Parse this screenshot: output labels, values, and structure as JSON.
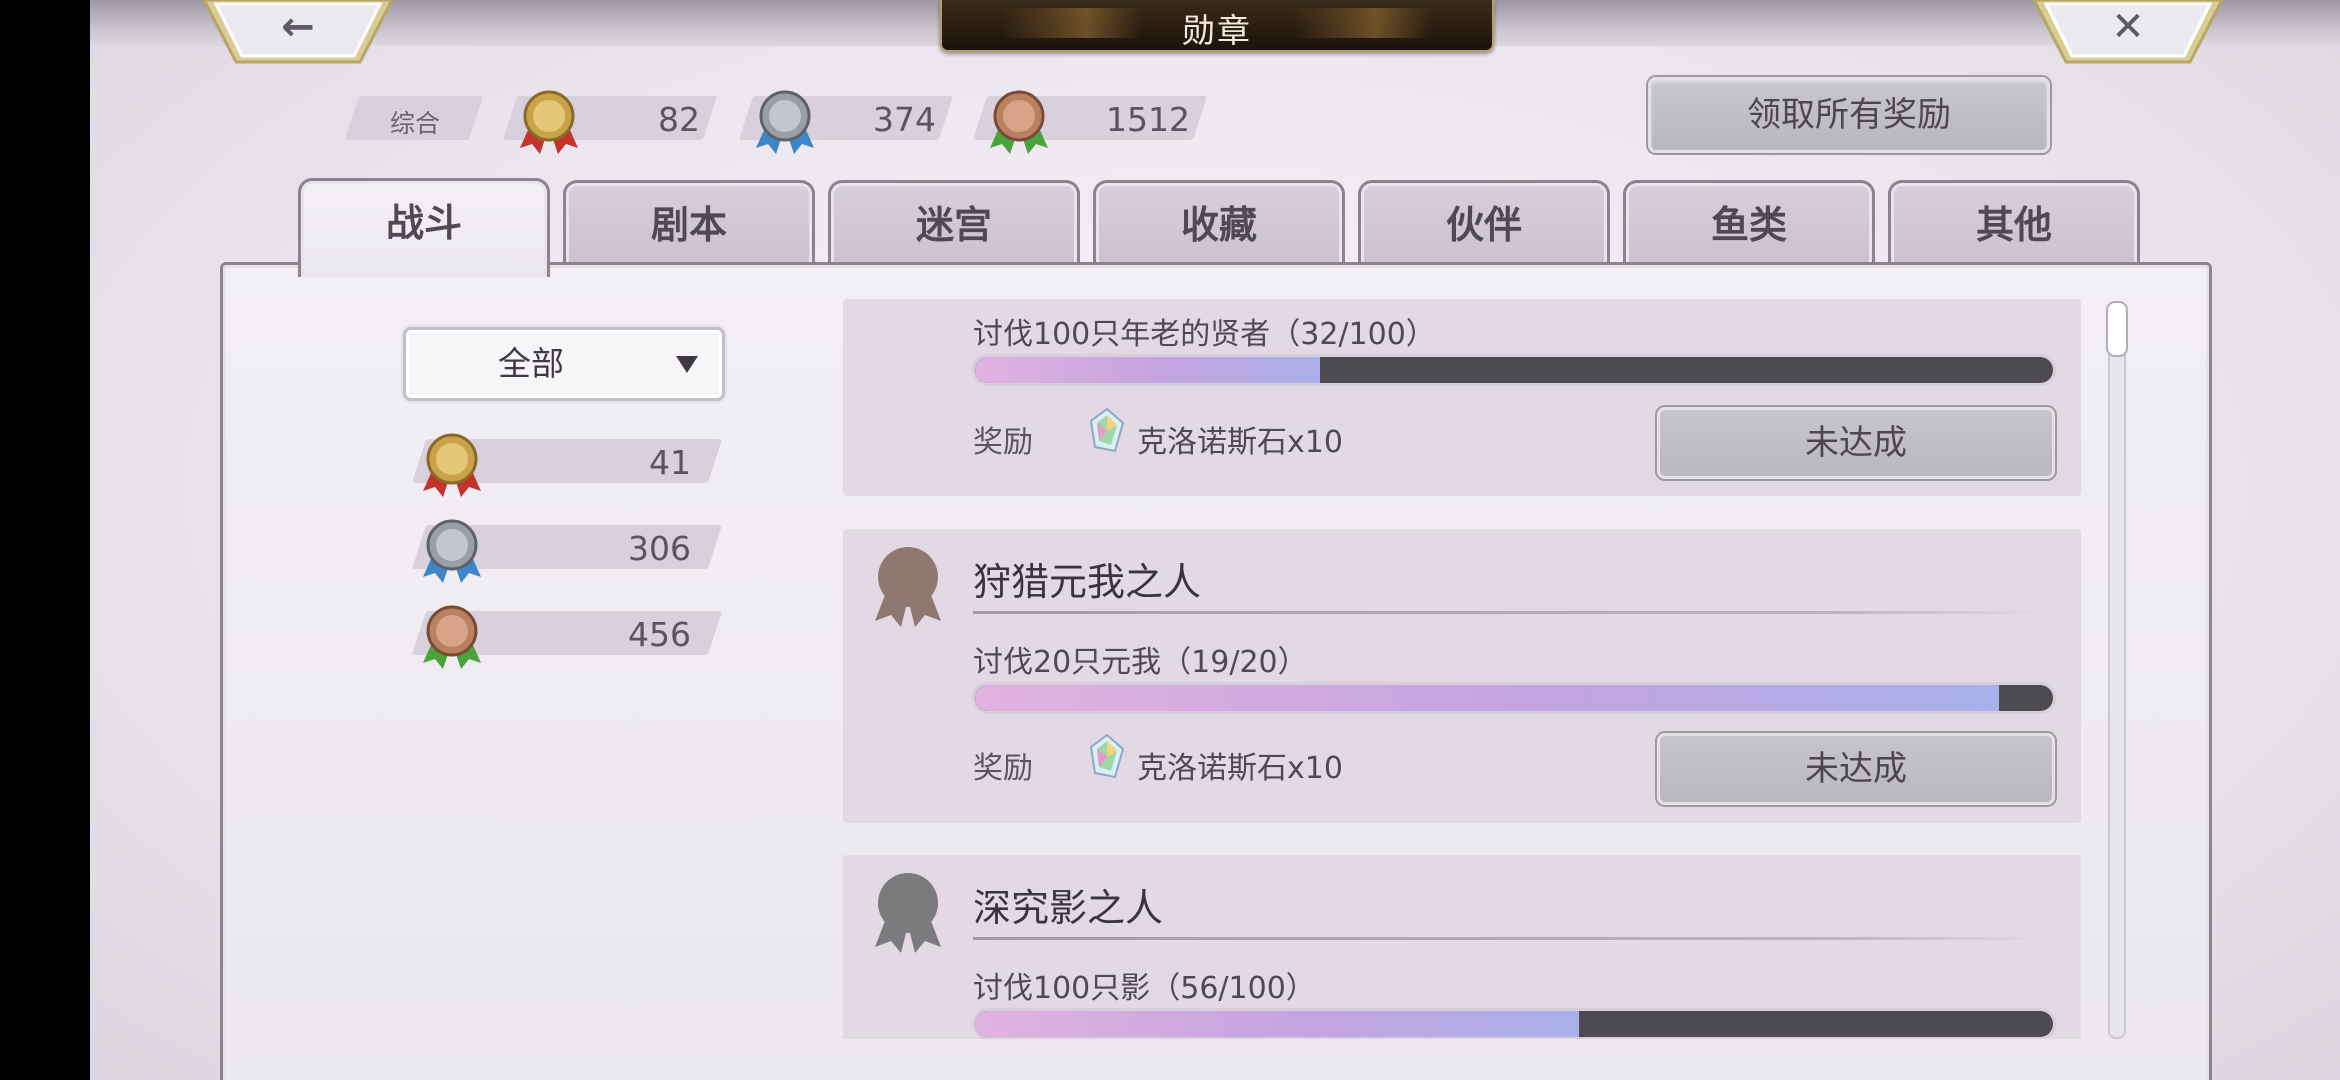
{
  "header": {
    "title": "勋章",
    "back_glyph": "←",
    "close_glyph": "✕"
  },
  "summary": {
    "label": "综合",
    "gold": "82",
    "silver": "374",
    "bronze": "1512"
  },
  "claim_all_label": "领取所有奖励",
  "tabs": [
    {
      "label": "战斗",
      "active": true
    },
    {
      "label": "剧本",
      "active": false
    },
    {
      "label": "迷宫",
      "active": false
    },
    {
      "label": "收藏",
      "active": false
    },
    {
      "label": "伙伴",
      "active": false
    },
    {
      "label": "鱼类",
      "active": false
    },
    {
      "label": "其他",
      "active": false
    }
  ],
  "filter": {
    "selected": "全部"
  },
  "category_counts": {
    "gold": "41",
    "silver": "306",
    "bronze": "456"
  },
  "achievements": [
    {
      "title": "",
      "requirement": "讨伐100只年老的贤者（32/100）",
      "progress": 0.32,
      "reward_label": "奖励",
      "reward": "克洛诺斯石x10",
      "status": "未达成"
    },
    {
      "title": "狩猎元我之人",
      "requirement": "讨伐20只元我（19/20）",
      "progress": 0.95,
      "reward_label": "奖励",
      "reward": "克洛诺斯石x10",
      "status": "未达成",
      "medal_color": "#8f7772"
    },
    {
      "title": "深究影之人",
      "requirement": "讨伐100只影（56/100）",
      "progress": 0.56,
      "medal_color": "#7b7a7d"
    }
  ],
  "colors": {
    "gold": "#c9a24a",
    "silver": "#9a9ea6",
    "bronze": "#b98062",
    "ribbon_red": "#c2342c",
    "ribbon_blue": "#3d86c8",
    "ribbon_green": "#4aa33a"
  }
}
